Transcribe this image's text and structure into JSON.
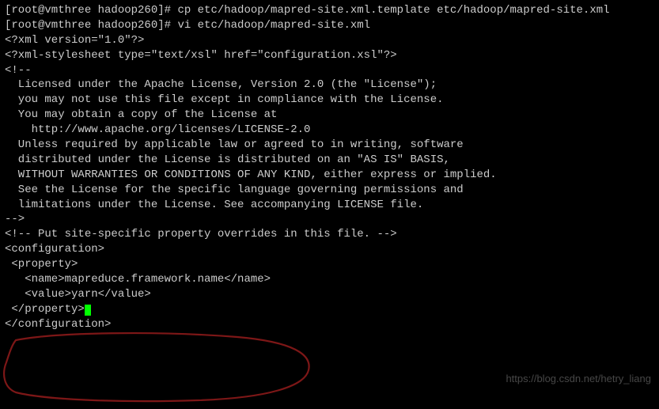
{
  "terminal": {
    "prompt1": "[root@vmthree hadoop260]# ",
    "cmd1": "cp etc/hadoop/mapred-site.xml.template etc/hadoop/mapred-site.xml",
    "prompt2": "[root@vmthree hadoop260]# ",
    "cmd2": "vi etc/hadoop/mapred-site.xml",
    "blank": "",
    "l1": "<?xml version=\"1.0\"?>",
    "l2": "<?xml-stylesheet type=\"text/xsl\" href=\"configuration.xsl\"?>",
    "l3": "<!--",
    "l4": "  Licensed under the Apache License, Version 2.0 (the \"License\");",
    "l5": "  you may not use this file except in compliance with the License.",
    "l6": "  You may obtain a copy of the License at",
    "l7": "",
    "l8": "    http://www.apache.org/licenses/LICENSE-2.0",
    "l9": "",
    "l10": "  Unless required by applicable law or agreed to in writing, software",
    "l11": "  distributed under the License is distributed on an \"AS IS\" BASIS,",
    "l12": "  WITHOUT WARRANTIES OR CONDITIONS OF ANY KIND, either express or implied.",
    "l13": "  See the License for the specific language governing permissions and",
    "l14": "  limitations under the License. See accompanying LICENSE file.",
    "l15": "-->",
    "l16": "",
    "l17": "<!-- Put site-specific property overrides in this file. -->",
    "l18": "",
    "l19": "<configuration>",
    "l20": " <property>",
    "l21": "   <name>mapreduce.framework.name</name>",
    "l22": "   <value>yarn</value>",
    "l23": " </property>",
    "l24": "</configuration>"
  },
  "watermark": "https://blog.csdn.net/hetry_liang"
}
